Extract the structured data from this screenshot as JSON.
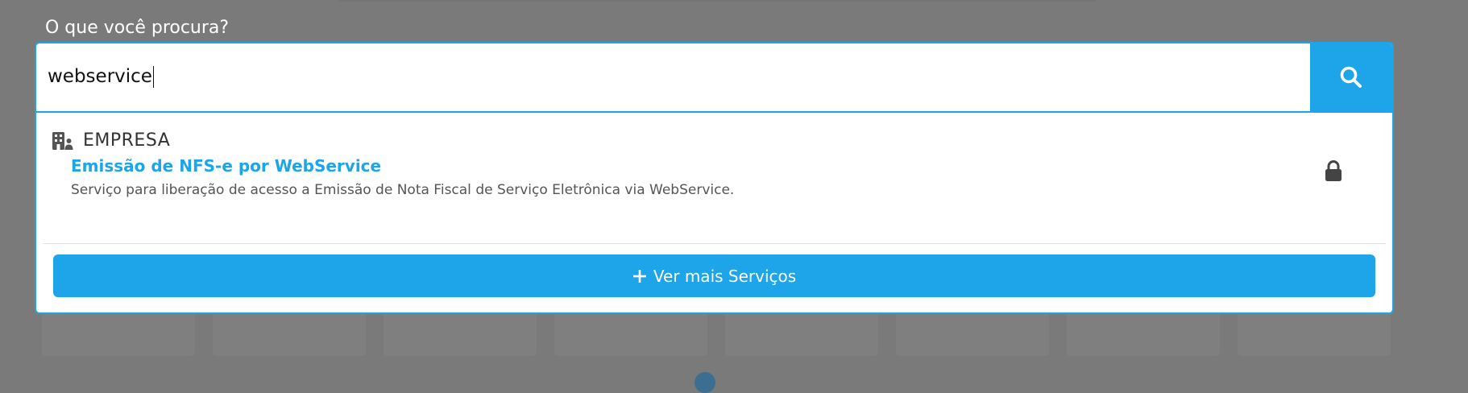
{
  "search": {
    "label": "O que você procura?",
    "value": "webservice"
  },
  "results": {
    "category": {
      "label": "EMPRESA",
      "icon": "building-user-icon"
    },
    "items": [
      {
        "title": "Emissão de NFS-e por WebService",
        "description": "Serviço para liberação de acesso a Emissão de Nota Fiscal de Serviço Eletrônica via WebService.",
        "icon": "lock-icon"
      }
    ]
  },
  "more_button": {
    "label": "Ver mais Serviços",
    "icon": "plus-icon"
  },
  "colors": {
    "accent": "#1ea4e8",
    "overlay": "#7a7a7a"
  }
}
